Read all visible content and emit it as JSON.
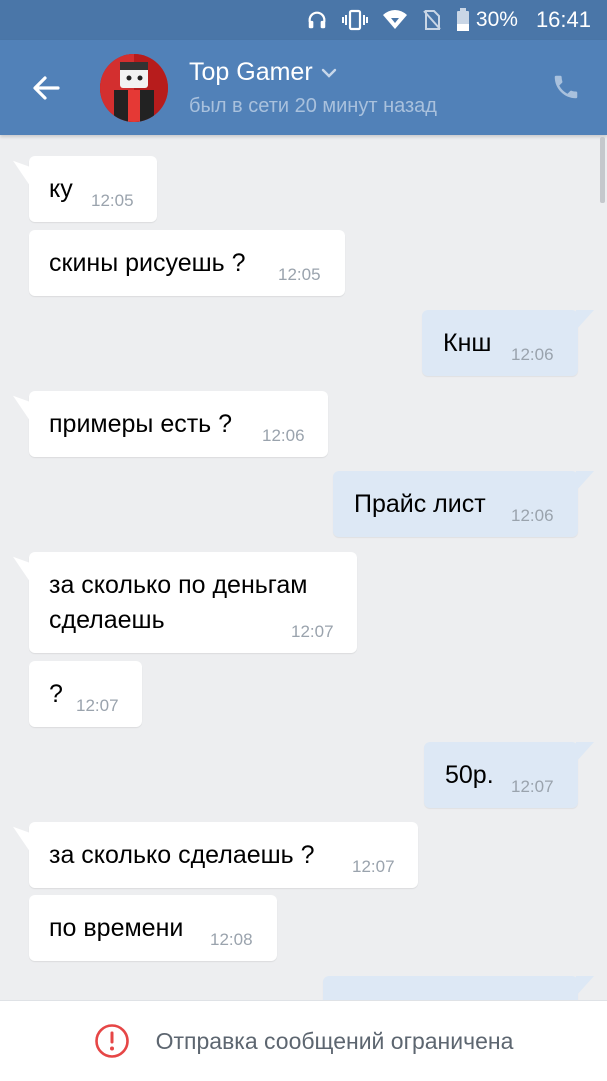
{
  "status_bar": {
    "battery": "30%",
    "time": "16:41"
  },
  "header": {
    "contact_name": "Top Gamer",
    "status": "был в сети 20 минут назад"
  },
  "messages": [
    {
      "dir": "in",
      "text": "ку",
      "time": "12:05"
    },
    {
      "dir": "in",
      "text": "скины рисуешь ?",
      "time": "12:05"
    },
    {
      "dir": "out",
      "text": "Кнш",
      "time": "12:06"
    },
    {
      "dir": "in",
      "text": "примеры есть ?",
      "time": "12:06"
    },
    {
      "dir": "out",
      "text": "Прайс лист",
      "time": "12:06"
    },
    {
      "dir": "in",
      "text_line1": "за сколько по деньгам",
      "text_line2": "сделаешь",
      "time": "12:07"
    },
    {
      "dir": "in",
      "text": "?",
      "time": "12:07"
    },
    {
      "dir": "out",
      "text": "50р.",
      "time": "12:07"
    },
    {
      "dir": "in",
      "text": "за сколько сделаешь ?",
      "time": "12:07"
    },
    {
      "dir": "in",
      "text": "по времени",
      "time": "12:08"
    }
  ],
  "bottom_bar": {
    "notice": "Отправка сообщений ограничена"
  },
  "colors": {
    "header": "#5181b8",
    "status_bar": "#4a76a8",
    "incoming": "#ffffff",
    "outgoing": "#dde8f5",
    "background": "#edeef0",
    "warning": "#e64646"
  }
}
